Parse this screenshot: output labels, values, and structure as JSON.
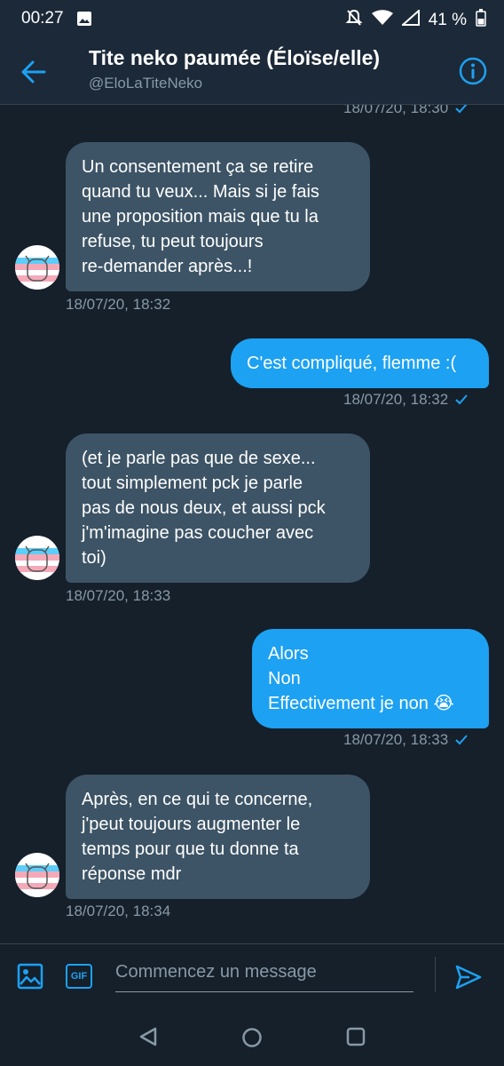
{
  "status": {
    "time": "00:27",
    "battery": "41 %"
  },
  "header": {
    "title": "Tite neko paumée (Éloïse/elle)",
    "handle": "@EloLaTiteNeko"
  },
  "conversation": {
    "top_timestamp": "18/07/20, 18:30",
    "messages": [
      {
        "direction": "in",
        "text": "Un consentement ça se retire\nquand tu veux... Mais si je fais\nune proposition mais que tu la\nrefuse, tu peut toujours\nre-demander après...!",
        "timestamp": "18/07/20, 18:32"
      },
      {
        "direction": "out",
        "text": "C'est compliqué, flemme :(",
        "timestamp": "18/07/20, 18:32"
      },
      {
        "direction": "in",
        "text": "(et je parle pas que de sexe...\ntout simplement pck je parle\npas de nous deux, et aussi pck\nj'm'imagine pas coucher avec\ntoi)",
        "timestamp": "18/07/20, 18:33"
      },
      {
        "direction": "out",
        "text": "Alors\nNon\nEffectivement je non 😭",
        "timestamp": "18/07/20, 18:33"
      },
      {
        "direction": "in",
        "text": "Après, en ce qui te concerne,\nj'peut toujours augmenter le\ntemps pour que tu donne ta\nréponse mdr",
        "timestamp": "18/07/20, 18:34"
      }
    ]
  },
  "composer": {
    "placeholder": "Commencez un message",
    "gif_label": "GIF"
  },
  "colors": {
    "background": "#15202b",
    "incoming_bubble": "#3d5466",
    "outgoing_bubble": "#1da1f2",
    "accent": "#1da1f2",
    "muted_text": "#8899a6"
  }
}
